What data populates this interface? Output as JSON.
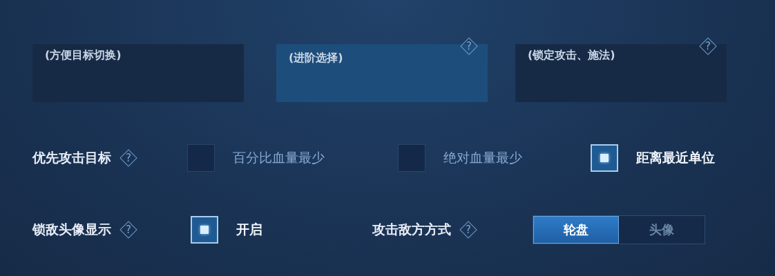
{
  "cards": [
    {
      "caption": "(方便目标切换)",
      "selected": false
    },
    {
      "caption": "(进阶选择)",
      "selected": true,
      "help": "?"
    },
    {
      "caption": "(锁定攻击、施法)",
      "selected": false,
      "help": "?"
    }
  ],
  "priority": {
    "label": "优先攻击目标",
    "help": "?",
    "options": [
      {
        "label": "百分比血量最少",
        "checked": false
      },
      {
        "label": "绝对血量最少",
        "checked": false
      },
      {
        "label": "距离最近单位",
        "checked": true
      }
    ]
  },
  "lock_avatar": {
    "label": "锁敌头像显示",
    "help": "?",
    "option": {
      "label": "开启",
      "checked": true
    }
  },
  "attack_mode": {
    "label": "攻击敌方方式",
    "help": "?",
    "segments": [
      {
        "label": "轮盘",
        "selected": true
      },
      {
        "label": "头像",
        "selected": false
      }
    ]
  }
}
